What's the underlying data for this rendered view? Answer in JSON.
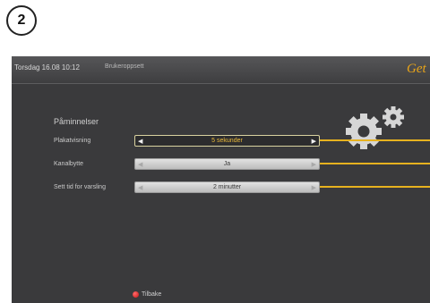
{
  "step_number": "2",
  "header": {
    "datetime": "Torsdag 16.08 10:12",
    "title": "Brukeroppsett",
    "logo": "Get"
  },
  "section": {
    "title": "Påminnelser"
  },
  "rows": [
    {
      "label": "Plakatvisning",
      "value": "5 sekunder",
      "active": true
    },
    {
      "label": "Kanalbytte",
      "value": "Ja",
      "active": false
    },
    {
      "label": "Sett tid for varsling",
      "value": "2 minutter",
      "active": false
    }
  ],
  "footer": {
    "back_label": "Tilbake"
  },
  "colors": {
    "accent": "#e7b21f",
    "screen_bg": "#3a3a3c",
    "back_button": "#d62020"
  },
  "icons": {
    "gear": "gears-icon",
    "arrow_left": "arrow-left-icon",
    "arrow_right": "arrow-right-icon",
    "back": "red-dot-icon"
  }
}
